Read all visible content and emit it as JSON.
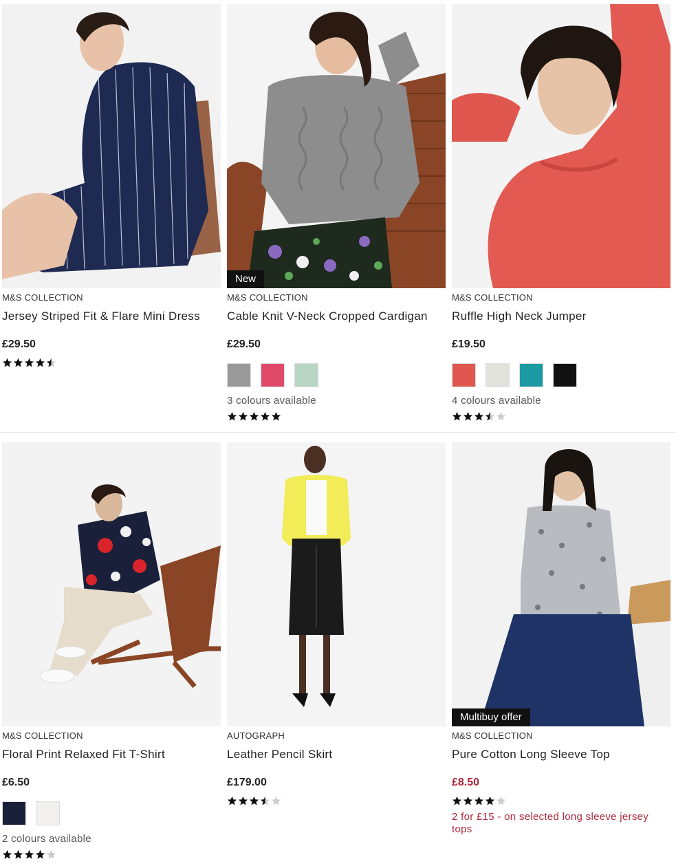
{
  "products": [
    {
      "brand": "M&S COLLECTION",
      "title": "Jersey Striped Fit & Flare Mini Dress",
      "price": "£29.50",
      "rating": 4.5,
      "tag": "",
      "swatches": [],
      "colours_text": "",
      "offer": ""
    },
    {
      "brand": "M&S COLLECTION",
      "title": "Cable Knit V-Neck Cropped Cardigan",
      "price": "£29.50",
      "rating": 5,
      "tag": "New",
      "swatches": [
        "#9a9a9a",
        "#e04a6a",
        "#b9d6c4"
      ],
      "colours_text": "3 colours available",
      "offer": ""
    },
    {
      "brand": "M&S COLLECTION",
      "title": "Ruffle High Neck Jumper",
      "price": "£19.50",
      "rating": 3.5,
      "tag": "",
      "swatches": [
        "#e0574f",
        "#e2e2dc",
        "#1b9aa3",
        "#111111"
      ],
      "colours_text": "4 colours available",
      "offer": ""
    },
    {
      "brand": "M&S COLLECTION",
      "title": "Floral Print Relaxed Fit T-Shirt",
      "price": "£6.50",
      "rating": 4,
      "tag": "",
      "swatches": [
        "#1a1f3a",
        "#f2f0ec"
      ],
      "colours_text": "2 colours available",
      "offer": ""
    },
    {
      "brand": "AUTOGRAPH",
      "title": "Leather Pencil Skirt",
      "price": "£179.00",
      "rating": 3.5,
      "tag": "",
      "swatches": [],
      "colours_text": "",
      "offer": ""
    },
    {
      "brand": "M&S COLLECTION",
      "title": "Pure Cotton Long Sleeve Top",
      "price": "£8.50",
      "rating": 4,
      "tag": "Multibuy offer",
      "swatches": [],
      "colours_text": "",
      "offer": "2 for £15 - on selected long sleeve jersey tops"
    }
  ],
  "colors": {
    "sale": "#b0273b",
    "tag_bg": "#111111",
    "star": "#111111",
    "star_empty": "#cccccc"
  }
}
